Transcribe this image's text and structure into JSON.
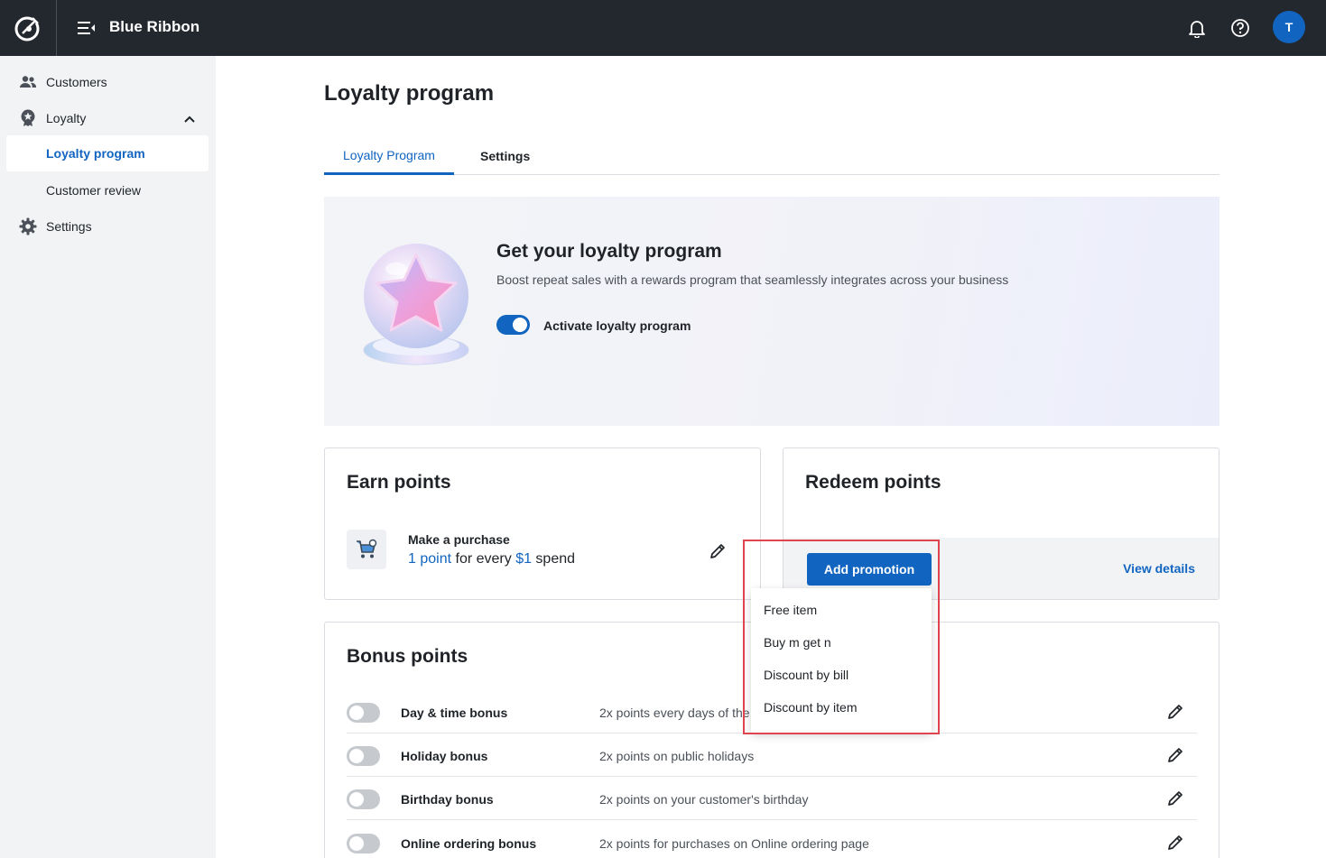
{
  "topbar": {
    "brand": "Blue Ribbon",
    "avatar_initial": "T",
    "icons": [
      "app-logo-icon",
      "menu-collapse-icon",
      "bell-icon",
      "help-icon"
    ]
  },
  "sidebar": {
    "items": [
      {
        "label": "Customers",
        "icon": "customers-icon"
      },
      {
        "label": "Loyalty",
        "icon": "loyalty-badge-icon"
      },
      {
        "label": "Loyalty program"
      },
      {
        "label": "Customer review"
      },
      {
        "label": "Settings",
        "icon": "gear-icon"
      }
    ]
  },
  "main": {
    "title": "Loyalty program",
    "tabs": [
      {
        "label": "Loyalty Program",
        "active": true
      },
      {
        "label": "Settings",
        "active": false
      }
    ],
    "hero": {
      "title": "Get your loyalty program",
      "description": "Boost repeat sales with a rewards program that seamlessly integrates across your business",
      "toggle_label": "Activate loyalty program",
      "toggle_on": true
    },
    "earn": {
      "title": "Earn points",
      "rule_title": "Make a purchase",
      "rule_points": "1 point",
      "rule_mid": " for every ",
      "rule_amount": "$1",
      "rule_end": " spend"
    },
    "redeem": {
      "title": "Redeem points",
      "add_button": "Add promotion",
      "view_details": "View details"
    },
    "promo_menu": [
      "Free item",
      "Buy m get n",
      "Discount by bill",
      "Discount by item"
    ],
    "bonus": {
      "title": "Bonus points",
      "rows": [
        {
          "name": "Day & time bonus",
          "desc": "2x points every days of the week"
        },
        {
          "name": "Holiday bonus",
          "desc": "2x points on public holidays"
        },
        {
          "name": "Birthday bonus",
          "desc": "2x points on your customer's birthday"
        },
        {
          "name": "Online ordering bonus",
          "desc": "2x points for purchases on Online ordering page"
        }
      ]
    }
  },
  "colors": {
    "topbar": "#23272e",
    "accent": "#1165c1",
    "sidebar_bg": "#f2f3f5",
    "highlight_border": "#e0454f"
  }
}
